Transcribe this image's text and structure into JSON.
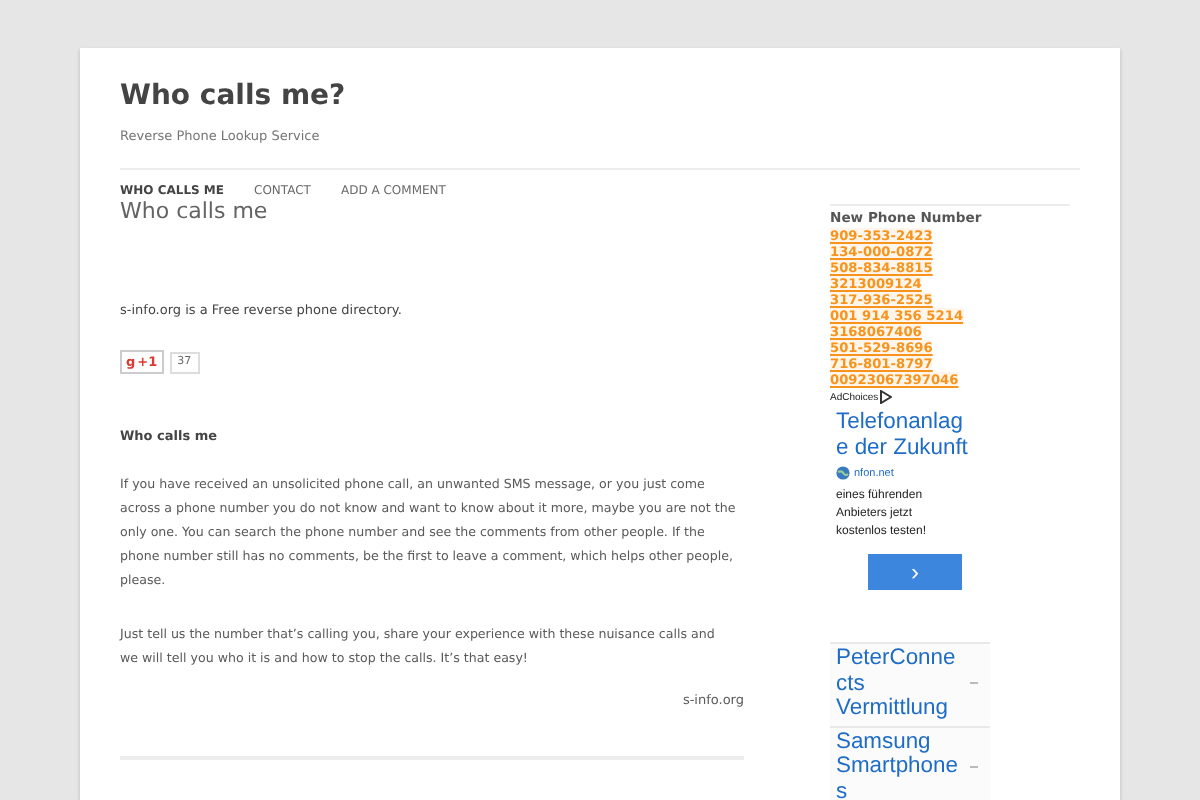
{
  "site": {
    "title": "Who calls me?",
    "tagline": "Reverse Phone Lookup Service"
  },
  "nav": [
    {
      "label": "WHO CALLS ME",
      "selected": true
    },
    {
      "label": "CONTACT",
      "selected": false
    },
    {
      "label": "ADD A COMMENT",
      "selected": false
    }
  ],
  "page": {
    "title": "Who calls me",
    "intro": "s-info.org is a Free reverse phone directory.",
    "plus_one": {
      "icon": "g",
      "label": "+1",
      "count": "37"
    },
    "heading": "Who calls me",
    "paragraphs": [
      "If you have received an unsolicited phone call, an unwanted SMS message, or you just come across a phone number you do not know and want to know about it more, maybe you are not the only one. You can search the phone number and see the comments from other people. If the phone number still has no comments, be the first to leave a comment, which helps other people, please.",
      "Just tell us the number that’s calling you, share your experience with these nuisance calls and we will tell you who it is and how to stop the calls. It’s that easy!"
    ],
    "signature": "s-info.org"
  },
  "sidebar": {
    "heading": "New Phone Number",
    "numbers": [
      "909-353-2423",
      "134-000-0872",
      "508-834-8815",
      "3213009124",
      "317-936-2525",
      "001 914 356 5214",
      "3168067406",
      "501-529-8696",
      "716-801-8797",
      "00923067397046"
    ],
    "ad": {
      "adchoices": "AdChoices",
      "title": "Telefonanlage der Zukunft",
      "domain": "nfon.net",
      "text": "eines führenden Anbieters jetzt kostenlos testen!",
      "button": "›"
    },
    "links": [
      "PeterConnects Vermittlung",
      "Samsung Smartphones"
    ]
  }
}
